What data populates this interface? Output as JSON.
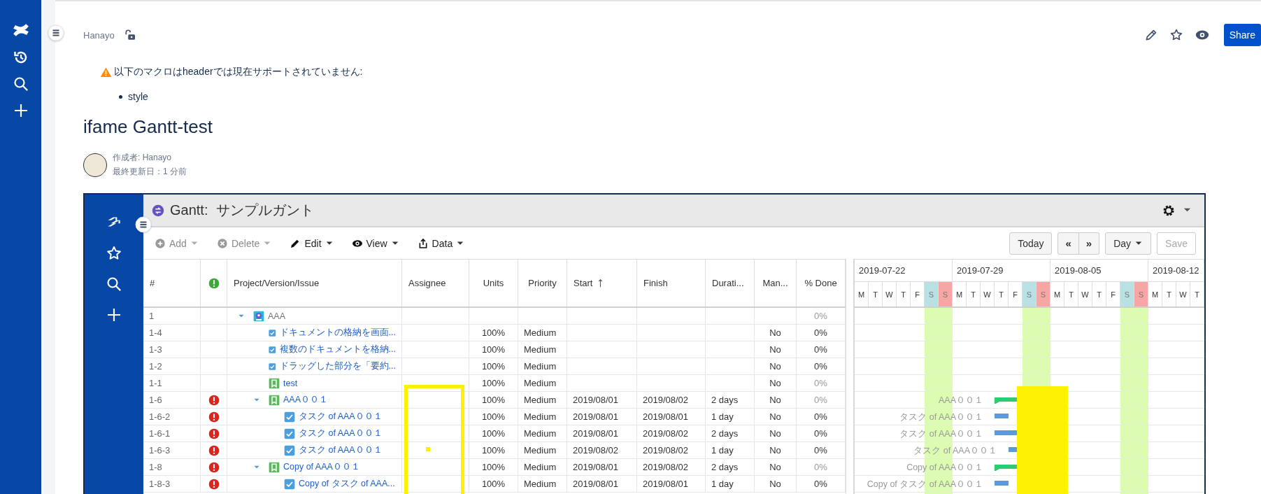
{
  "breadcrumb": {
    "space": "Hanayo"
  },
  "actions": {
    "share": "Share"
  },
  "macro_warning": {
    "message": "以下のマクロはheaderでは現在サポートされていません:",
    "items": [
      "style"
    ]
  },
  "page": {
    "title": "ifame Gantt-test",
    "author": "作成者: Hanayo",
    "updated": "最終更新日：1 分前"
  },
  "gantt": {
    "title": "Gantt:  サンプルガント",
    "toolbar": [
      {
        "label": "Add",
        "kind": "add",
        "disabled": true
      },
      {
        "label": "Delete",
        "kind": "delete",
        "disabled": true
      },
      {
        "label": "Edit",
        "kind": "edit",
        "disabled": false
      },
      {
        "label": "View",
        "kind": "view",
        "disabled": false
      },
      {
        "label": "Data",
        "kind": "data",
        "disabled": false
      }
    ],
    "nav_buttons": {
      "today": "Today",
      "previous": "«",
      "next": "»",
      "scale": "Day",
      "save": {
        "label": "Save",
        "disabled": true
      }
    },
    "columns": [
      {
        "kind": "text",
        "label": "#",
        "sorted": false
      },
      {
        "kind": "alert",
        "sorted": false
      },
      {
        "kind": "text",
        "label": "Project/Version/Issue",
        "sorted": false
      },
      {
        "kind": "text",
        "label": "Assignee",
        "sorted": false
      },
      {
        "kind": "text",
        "label": "Units",
        "sorted": false
      },
      {
        "kind": "text",
        "label": "Priority",
        "sorted": false
      },
      {
        "kind": "text",
        "label": "Start",
        "sorted": true
      },
      {
        "kind": "text",
        "label": "Finish",
        "sorted": false
      },
      {
        "kind": "text",
        "label": "Durati...",
        "sorted": false
      },
      {
        "kind": "text",
        "label": "Man...",
        "sorted": false
      },
      {
        "kind": "text",
        "label": "% Done",
        "sorted": false
      }
    ],
    "rows": [
      {
        "id": "1",
        "alert": false,
        "kind": "project",
        "name": "AAA",
        "done": "0%",
        "expanded": true,
        "children": [
          {
            "id": "1-4",
            "alert": false,
            "kind": "task",
            "name": "ドキュメントの格納を画面...",
            "units": "100%",
            "priority": "Medium",
            "manual": "No",
            "done": "0%"
          },
          {
            "id": "1-3",
            "alert": false,
            "kind": "task",
            "name": "複数のドキュメントを格納...",
            "units": "100%",
            "priority": "Medium",
            "manual": "No",
            "done": "0%"
          },
          {
            "id": "1-2",
            "alert": false,
            "kind": "task",
            "name": "ドラッグした部分を「要約...",
            "units": "100%",
            "priority": "Medium",
            "manual": "No",
            "done": "0%"
          },
          {
            "id": "1-1",
            "alert": false,
            "kind": "version",
            "name": "test",
            "units": "100%",
            "priority": "Medium",
            "manual": "No",
            "done": "0%"
          },
          {
            "id": "1-6",
            "alert": true,
            "kind": "version",
            "name": "AAA００１",
            "units": "100%",
            "priority": "Medium",
            "start": "2019/08/01",
            "finish": "2019/08/02",
            "duration": "2 days",
            "manual": "No",
            "done": "0%",
            "bar_label": "AAA００１",
            "expanded": true,
            "children": [
              {
                "id": "1-6-2",
                "alert": true,
                "kind": "task",
                "name": "タスク of AAA００１",
                "units": "100%",
                "priority": "Medium",
                "start": "2019/08/01",
                "finish": "2019/08/01",
                "duration": "1 day",
                "manual": "No",
                "done": "0%",
                "bar_label": "タスク of AAA００１"
              },
              {
                "id": "1-6-1",
                "alert": true,
                "kind": "task",
                "name": "タスク of AAA００１",
                "units": "100%",
                "priority": "Medium",
                "start": "2019/08/01",
                "finish": "2019/08/02",
                "duration": "2 days",
                "manual": "No",
                "done": "0%",
                "bar_label": "タスク of AAA００１"
              },
              {
                "id": "1-6-3",
                "alert": true,
                "kind": "task",
                "name": "タスク of AAA００１",
                "units": "100%",
                "priority": "Medium",
                "start": "2019/08/02",
                "finish": "2019/08/02",
                "duration": "1 day",
                "manual": "No",
                "done": "0%",
                "bar_label": "タスク of AAA００１"
              }
            ]
          },
          {
            "id": "1-8",
            "alert": true,
            "kind": "version",
            "name": "Copy of AAA００１",
            "units": "100%",
            "priority": "Medium",
            "start": "2019/08/01",
            "finish": "2019/08/02",
            "duration": "2 days",
            "manual": "No",
            "done": "0%",
            "bar_label": "Copy of AAA００１",
            "expanded": true,
            "children": [
              {
                "id": "1-8-3",
                "alert": true,
                "kind": "task",
                "name": "Copy of タスク of AAA...",
                "units": "100%",
                "priority": "Medium",
                "start": "2019/08/01",
                "finish": "2019/08/01",
                "duration": "1 day",
                "manual": "No",
                "done": "0%",
                "bar_label": "Copy of タスク of AAA００１"
              }
            ]
          }
        ]
      }
    ],
    "timeline": {
      "weeks": [
        "2019-07-22",
        "2019-07-29",
        "2019-08-05",
        "2019-08-12"
      ],
      "days": [
        {
          "label": "M",
          "kind": "weekday"
        },
        {
          "label": "T",
          "kind": "weekday"
        },
        {
          "label": "W",
          "kind": "weekday"
        },
        {
          "label": "T",
          "kind": "weekday"
        },
        {
          "label": "F",
          "kind": "weekday"
        },
        {
          "label": "S",
          "kind": "saturday"
        },
        {
          "label": "S",
          "kind": "sunday"
        },
        {
          "label": "M",
          "kind": "weekday"
        },
        {
          "label": "T",
          "kind": "weekday"
        },
        {
          "label": "W",
          "kind": "weekday"
        },
        {
          "label": "T",
          "kind": "weekday"
        },
        {
          "label": "F",
          "kind": "weekday"
        },
        {
          "label": "S",
          "kind": "saturday"
        },
        {
          "label": "S",
          "kind": "sunday"
        },
        {
          "label": "M",
          "kind": "weekday"
        },
        {
          "label": "T",
          "kind": "weekday"
        },
        {
          "label": "W",
          "kind": "weekday"
        },
        {
          "label": "T",
          "kind": "weekday"
        },
        {
          "label": "F",
          "kind": "weekday"
        },
        {
          "label": "S",
          "kind": "saturday"
        },
        {
          "label": "S",
          "kind": "sunday"
        },
        {
          "label": "M",
          "kind": "weekday"
        },
        {
          "label": "T",
          "kind": "weekday"
        },
        {
          "label": "W",
          "kind": "weekday"
        },
        {
          "label": "T",
          "kind": "weekday"
        }
      ]
    }
  }
}
